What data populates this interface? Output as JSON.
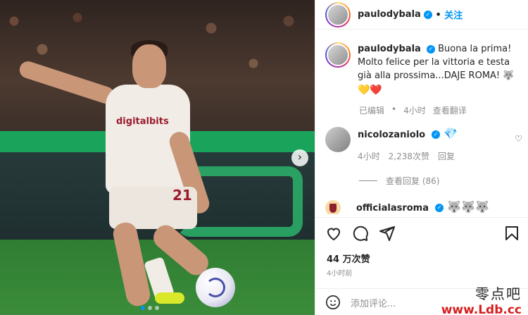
{
  "post": {
    "username": "paulodybala",
    "follow_label": "关注",
    "separator": "•",
    "caption_text": "Buona la prima! Molto felice per la vittoria e testa già alla prossima...DAJE ROMA! 🐺",
    "caption_emojis": "💛❤️",
    "edited_label": "已编辑",
    "caption_time": "4小时",
    "translate_label": "查看翻译",
    "likes": "44 万次赞",
    "time_ago": "4小时前",
    "add_comment_placeholder": "添加评论..."
  },
  "comments": [
    {
      "username": "nicolozaniolo",
      "text": "💎",
      "time": "4小时",
      "likes": "2,238次赞",
      "reply_label": "回复",
      "view_replies": "查看回复 (86)"
    },
    {
      "username": "officialasroma",
      "text": "🐺🐺🐺"
    }
  ],
  "photo": {
    "sponsor": "digitalbits",
    "shirt_number": "21",
    "carousel_dots": 3,
    "active_dot": 1
  },
  "watermark": {
    "line1": "零点吧",
    "line2": "www.Ldb.cc"
  },
  "colors": {
    "accent": "#0095f6",
    "secondary_text": "#8e8e8e",
    "heart_red": "#ed4956"
  },
  "icons": [
    "heart-icon",
    "comment-icon",
    "share-icon",
    "bookmark-icon",
    "smile-icon",
    "chevron-right-icon",
    "verified-icon"
  ]
}
